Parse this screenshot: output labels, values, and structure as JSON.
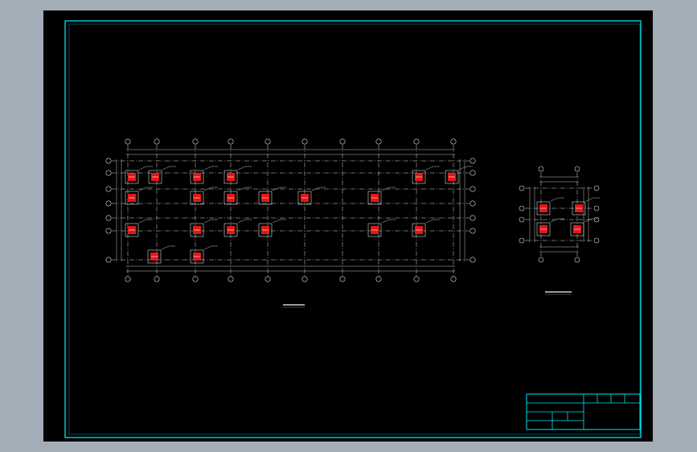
{
  "viewport": {
    "background": "#000000",
    "frame_color": "#00e5ee"
  },
  "colors": {
    "grid": "#d8d8d8",
    "dimension": "#bfbfbf",
    "column_fill": "#e2171a",
    "column_outline": "#ffffff",
    "border": "#00e5ee"
  },
  "drawings": {
    "main_plan": {
      "title": "",
      "grid_columns": 10,
      "grid_rows": 7
    },
    "detail_plan": {
      "title": "",
      "grid_columns": 3,
      "grid_rows": 4
    }
  },
  "title_block": {
    "rows": 4
  }
}
